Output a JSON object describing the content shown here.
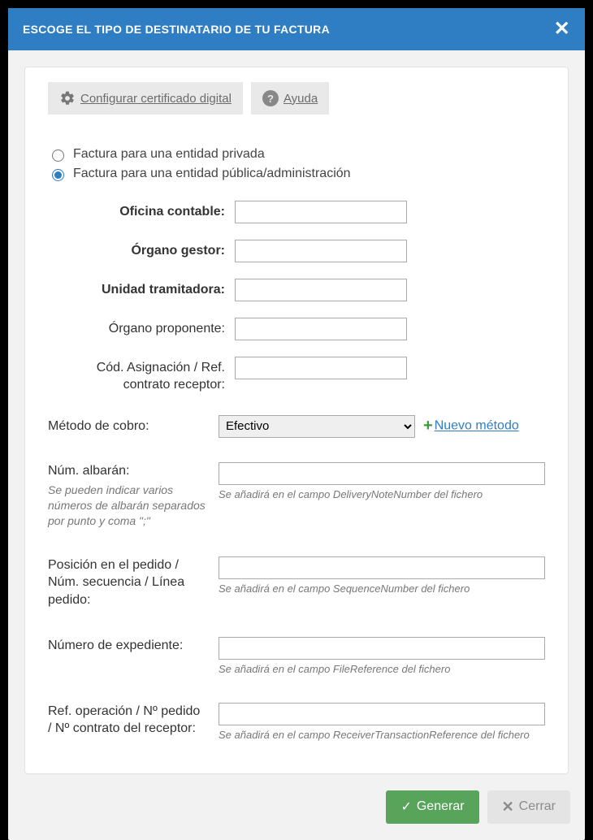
{
  "header": {
    "title": "ESCOGE EL TIPO DE DESTINATARIO DE TU FACTURA"
  },
  "top_buttons": {
    "config_cert": "Configurar certificado digital",
    "help": "Ayuda"
  },
  "radios": {
    "private": "Factura para una entidad privada",
    "public": "Factura para una entidad pública/administración"
  },
  "fields": {
    "oficina_label": "Oficina contable:",
    "organo_gestor_label": "Órgano gestor:",
    "unidad_label": "Unidad tramitadora:",
    "organo_proponente_label": "Órgano proponente:",
    "cod_asignacion_label": "Cód. Asignación / Ref. contrato receptor:",
    "oficina_value": "",
    "organo_gestor_value": "",
    "unidad_value": "",
    "organo_proponente_value": "",
    "cod_asignacion_value": ""
  },
  "payment": {
    "label": "Método de cobro:",
    "selected": "Efectivo",
    "new_method": "Nuevo método"
  },
  "extras": {
    "albaran_label": "Núm. albarán:",
    "albaran_label_hint": "Se pueden indicar varios números de albarán separados por punto y coma \";\"",
    "albaran_hint": "Se añadirá en el campo DeliveryNoteNumber del fichero",
    "albaran_value": "",
    "posicion_label": "Posición en el pedido / Núm. secuencia / Línea pedido:",
    "posicion_hint": "Se añadirá en el campo SequenceNumber del fichero",
    "posicion_value": "",
    "expediente_label": "Número de expediente:",
    "expediente_hint": "Se añadirá en el campo FileReference del fichero",
    "expediente_value": "",
    "ref_operacion_label": "Ref. operación / Nº pedido / Nº contrato del receptor:",
    "ref_operacion_hint": "Se añadirá en el campo ReceiverTransactionReference del fichero",
    "ref_operacion_value": ""
  },
  "footer": {
    "generate": "Generar",
    "close": "Cerrar"
  }
}
